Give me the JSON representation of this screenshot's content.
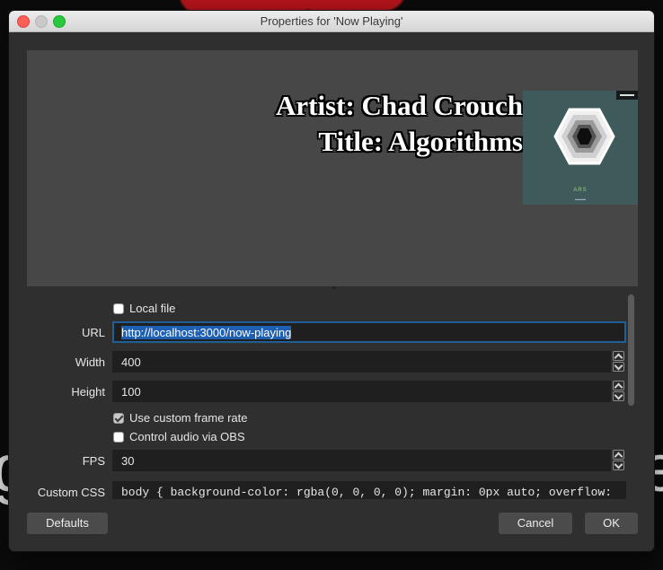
{
  "window": {
    "title": "Properties for 'Now Playing'"
  },
  "preview": {
    "artist_line": "Artist: Chad Crouch",
    "title_line": "Title: Algorithms",
    "album_text": "ARS"
  },
  "form": {
    "local_file": {
      "label": "Local file",
      "checked": false
    },
    "url": {
      "label": "URL",
      "value": "http://localhost:3000/now-playing"
    },
    "width": {
      "label": "Width",
      "value": "400"
    },
    "height": {
      "label": "Height",
      "value": "100"
    },
    "custom_frame_rate": {
      "label": "Use custom frame rate",
      "checked": true
    },
    "control_audio": {
      "label": "Control audio via OBS",
      "checked": false
    },
    "fps": {
      "label": "FPS",
      "value": "30"
    },
    "custom_css": {
      "label": "Custom CSS",
      "value": "body { background-color: rgba(0, 0, 0, 0); margin: 0px auto; overflow:"
    }
  },
  "buttons": {
    "defaults": "Defaults",
    "cancel": "Cancel",
    "ok": "OK"
  },
  "backdrop": {
    "left_letter": "g",
    "right_letter": "e"
  },
  "colors": {
    "accent": "#1d5fb2",
    "backdrop_red": "#b3151b",
    "close": "#fd5f57",
    "maximize": "#28c840"
  }
}
